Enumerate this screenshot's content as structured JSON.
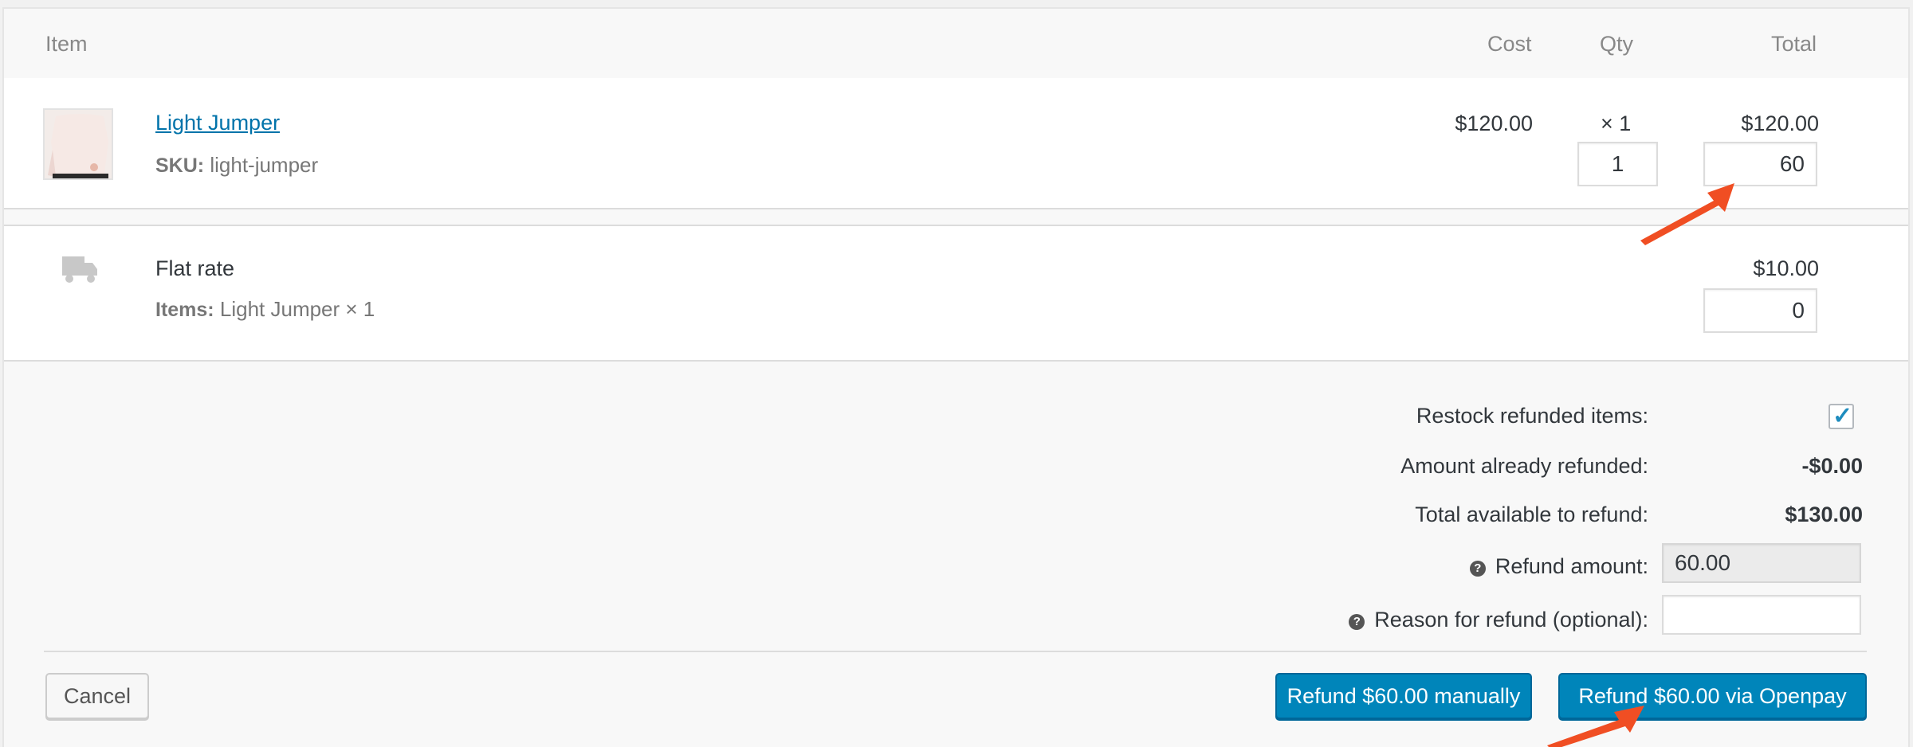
{
  "columns": {
    "item": "Item",
    "cost": "Cost",
    "qty": "Qty",
    "total": "Total"
  },
  "line_item": {
    "name": "Light Jumper",
    "sku_label": "SKU:",
    "sku_value": "light-jumper",
    "cost": "$120.00",
    "qty_display": "× 1",
    "total": "$120.00",
    "refund_qty": "1",
    "refund_total": "60"
  },
  "shipping": {
    "name": "Flat rate",
    "items_label": "Items:",
    "items_value": "Light Jumper × 1",
    "total": "$10.00",
    "refund_total": "0"
  },
  "refund": {
    "restock_label": "Restock refunded items:",
    "restock_checked": true,
    "already_label": "Amount already refunded:",
    "already_value": "-$0.00",
    "available_label": "Total available to refund:",
    "available_value": "$130.00",
    "amount_label": "Refund amount:",
    "amount_value": "60.00",
    "reason_label": "Reason for refund (optional):",
    "reason_value": ""
  },
  "buttons": {
    "cancel": "Cancel",
    "manual": "Refund $60.00 manually",
    "gateway": "Refund $60.00 via Openpay"
  },
  "colors": {
    "primary": "#0085ba",
    "link": "#0073aa",
    "annotation_arrow": "#f04e23"
  }
}
